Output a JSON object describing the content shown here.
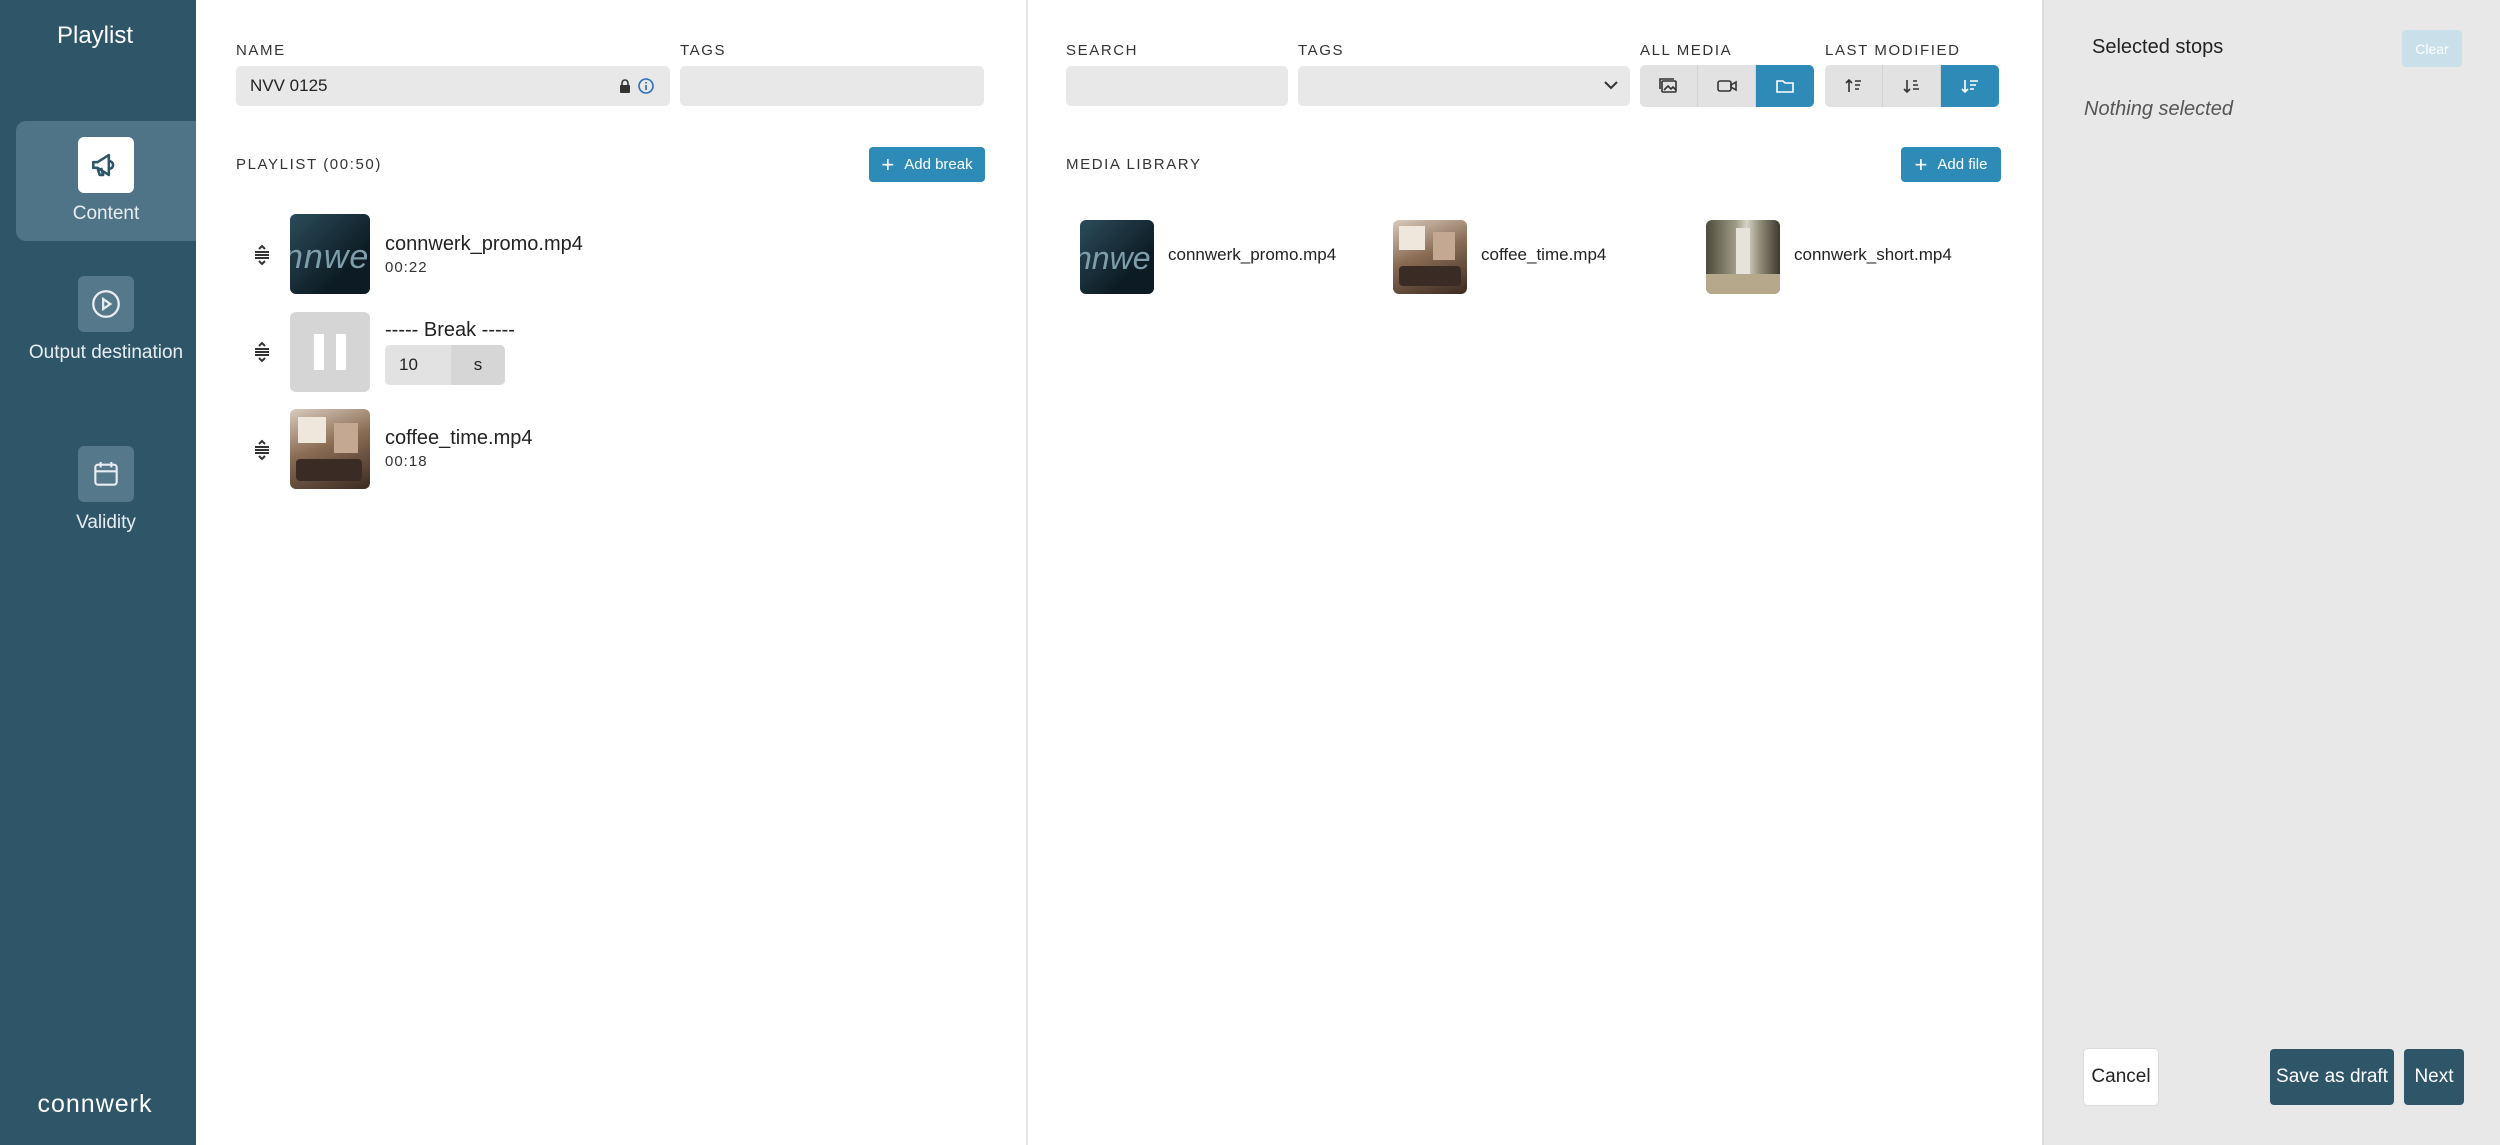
{
  "sidebar": {
    "title": "Playlist",
    "items": [
      {
        "label": "Content",
        "icon": "megaphone-icon",
        "active": true
      },
      {
        "label": "Output destination",
        "icon": "play-circle-icon",
        "active": false
      },
      {
        "label": "Validity",
        "icon": "calendar-icon",
        "active": false
      }
    ],
    "logo_text": "connwerk"
  },
  "playlist": {
    "name_label": "NAME",
    "name_value": "NVV 0125",
    "tags_label": "TAGS",
    "tags_value": "",
    "section_label": "PLAYLIST (00:50)",
    "add_break_label": "Add break",
    "items": [
      {
        "type": "media",
        "name": "connwerk_promo.mp4",
        "duration": "00:22"
      },
      {
        "type": "break",
        "name": "----- Break -----",
        "break_value": "10",
        "break_unit": "s"
      },
      {
        "type": "media",
        "name": "coffee_time.mp4",
        "duration": "00:18"
      }
    ]
  },
  "library": {
    "search_label": "SEARCH",
    "search_value": "",
    "tags_label": "TAGS",
    "tags_value": "",
    "all_media_label": "ALL MEDIA",
    "last_modified_label": "LAST MODIFIED",
    "filter_buttons": [
      {
        "icon": "image-icon",
        "active": false
      },
      {
        "icon": "video-icon",
        "active": false
      },
      {
        "icon": "folder-icon",
        "active": true
      }
    ],
    "sort_buttons": [
      {
        "icon": "sort-ascending-icon",
        "active": false
      },
      {
        "icon": "sort-descending-icon",
        "active": false
      },
      {
        "icon": "sort-lines-icon",
        "active": true
      }
    ],
    "section_label": "MEDIA LIBRARY",
    "add_file_label": "Add file",
    "files": [
      {
        "name": "connwerk_promo.mp4"
      },
      {
        "name": "coffee_time.mp4"
      },
      {
        "name": "connwerk_short.mp4"
      }
    ]
  },
  "selected": {
    "title": "Selected stops",
    "clear_label": "Clear",
    "empty_text": "Nothing selected",
    "cancel_label": "Cancel",
    "save_draft_label": "Save as draft",
    "next_label": "Next"
  },
  "colors": {
    "sidebar": "#2e5568",
    "accent": "#2e8bb8",
    "dark_button": "#2e5568"
  }
}
